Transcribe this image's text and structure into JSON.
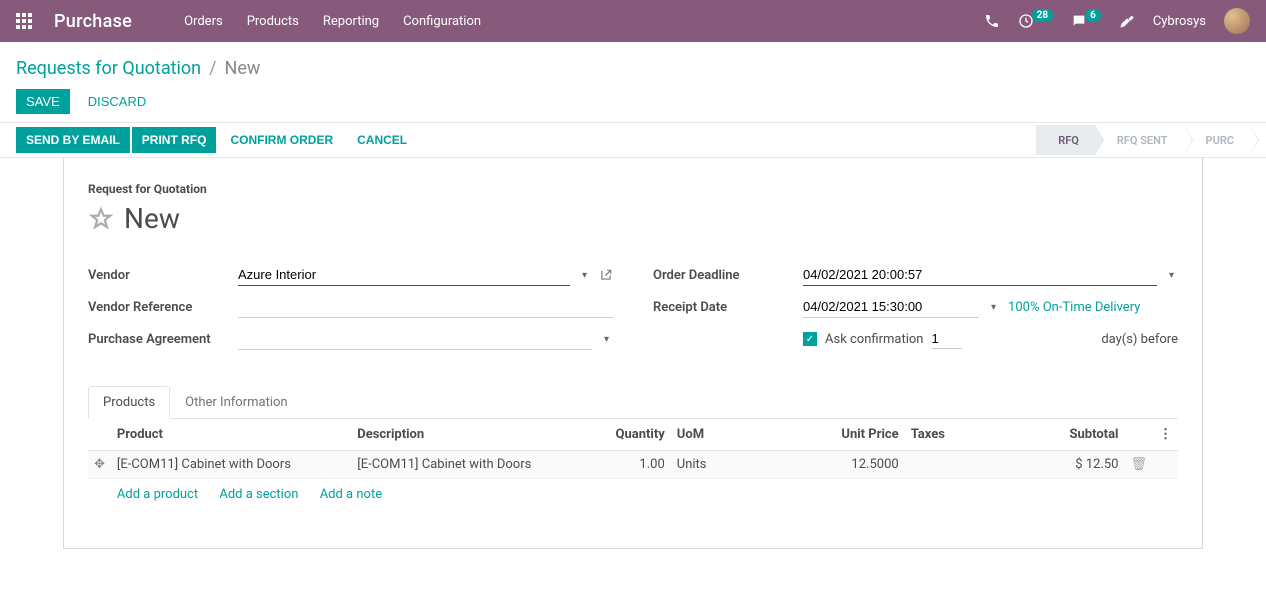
{
  "app": {
    "title": "Purchase"
  },
  "menu": [
    "Orders",
    "Products",
    "Reporting",
    "Configuration"
  ],
  "topbar": {
    "activities_badge": "28",
    "messages_badge": "6",
    "username": "Cybrosys"
  },
  "breadcrumb": {
    "parent": "Requests for Quotation",
    "current": "New"
  },
  "actions": {
    "save": "SAVE",
    "discard": "DISCARD"
  },
  "status_actions": {
    "send_email": "SEND BY EMAIL",
    "print_rfq": "PRINT RFQ",
    "confirm": "CONFIRM ORDER",
    "cancel": "CANCEL"
  },
  "stages": [
    "RFQ",
    "RFQ SENT",
    "PURC"
  ],
  "form": {
    "title_small": "Request for Quotation",
    "title": "New",
    "labels": {
      "vendor": "Vendor",
      "vendor_ref": "Vendor Reference",
      "purchase_agreement": "Purchase Agreement",
      "order_deadline": "Order Deadline",
      "receipt_date": "Receipt Date",
      "ask_confirmation": "Ask confirmation",
      "days_before": "day(s) before"
    },
    "vendor": "Azure Interior",
    "vendor_ref": "",
    "purchase_agreement": "",
    "order_deadline": "04/02/2021 20:00:57",
    "receipt_date": "04/02/2021 15:30:00",
    "ontime_delivery": "100% On-Time Delivery",
    "confirmation_days": "1"
  },
  "tabs": [
    "Products",
    "Other Information"
  ],
  "table": {
    "headers": {
      "product": "Product",
      "description": "Description",
      "quantity": "Quantity",
      "uom": "UoM",
      "unit_price": "Unit Price",
      "taxes": "Taxes",
      "subtotal": "Subtotal"
    },
    "rows": [
      {
        "product": "[E-COM11] Cabinet with Doors",
        "description": "[E-COM11] Cabinet with Doors",
        "quantity": "1.00",
        "uom": "Units",
        "unit_price": "12.5000",
        "taxes": "",
        "subtotal": "$ 12.50"
      }
    ],
    "add_product": "Add a product",
    "add_section": "Add a section",
    "add_note": "Add a note"
  }
}
